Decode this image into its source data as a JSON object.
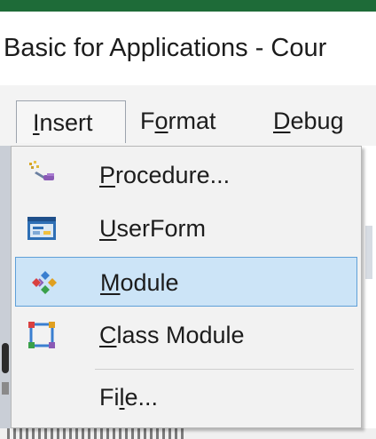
{
  "title_fragment": "Basic for Applications - Cour",
  "menubar": {
    "items": [
      {
        "pre": "",
        "u": "I",
        "post": "nsert"
      },
      {
        "pre": "F",
        "u": "o",
        "post": "rmat"
      },
      {
        "pre": "",
        "u": "D",
        "post": "ebug"
      }
    ]
  },
  "insert_menu": {
    "items": [
      {
        "u": "P",
        "rest": "rocedure...",
        "icon": "procedure-icon"
      },
      {
        "u": "U",
        "rest": "serForm",
        "icon": "userform-icon"
      },
      {
        "u": "M",
        "rest": "odule",
        "icon": "module-icon",
        "selected": true
      },
      {
        "u": "C",
        "rest": "lass Module",
        "icon": "class-module-icon"
      },
      {
        "pre": "Fi",
        "u": "l",
        "rest": "e...",
        "icon": ""
      }
    ]
  },
  "colors": {
    "title_bar_accent": "#1e6b38",
    "selection_bg": "#cce4f7",
    "selection_border": "#5fa0d8"
  }
}
